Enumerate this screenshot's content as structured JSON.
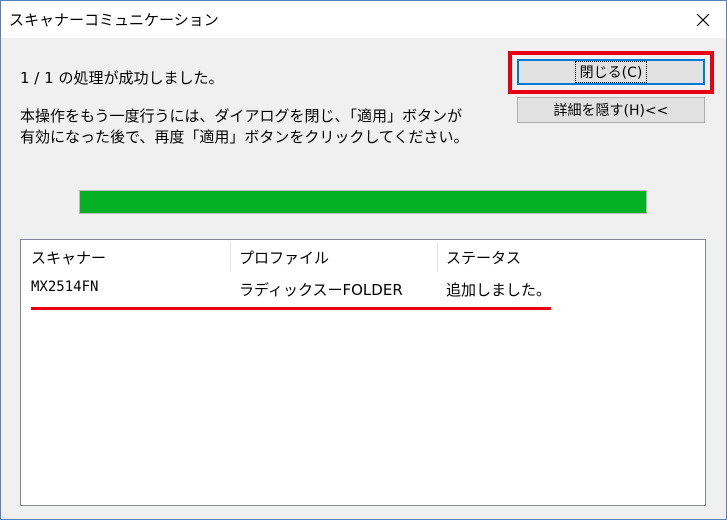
{
  "window": {
    "title": "スキャナーコミュニケーション"
  },
  "status_text": "1 / 1 の処理が成功しました。",
  "info_lines": [
    "本操作をもう一度行うには、ダイアログを閉じ、「適用」ボタンが",
    "有効になった後で、再度「適用」ボタンをクリックしてください。"
  ],
  "buttons": {
    "close": "閉じる(C)",
    "details": "詳細を隠す(H)<<"
  },
  "progress": {
    "fraction": 1.0,
    "color": "#06b025"
  },
  "list": {
    "columns": [
      "スキャナー",
      "プロファイル",
      "ステータス"
    ],
    "rows": [
      {
        "scanner": "MX2514FN",
        "profile": "ラディックスーFOLDER",
        "status": "追加しました。"
      }
    ]
  },
  "annotation_color": "#e60012"
}
